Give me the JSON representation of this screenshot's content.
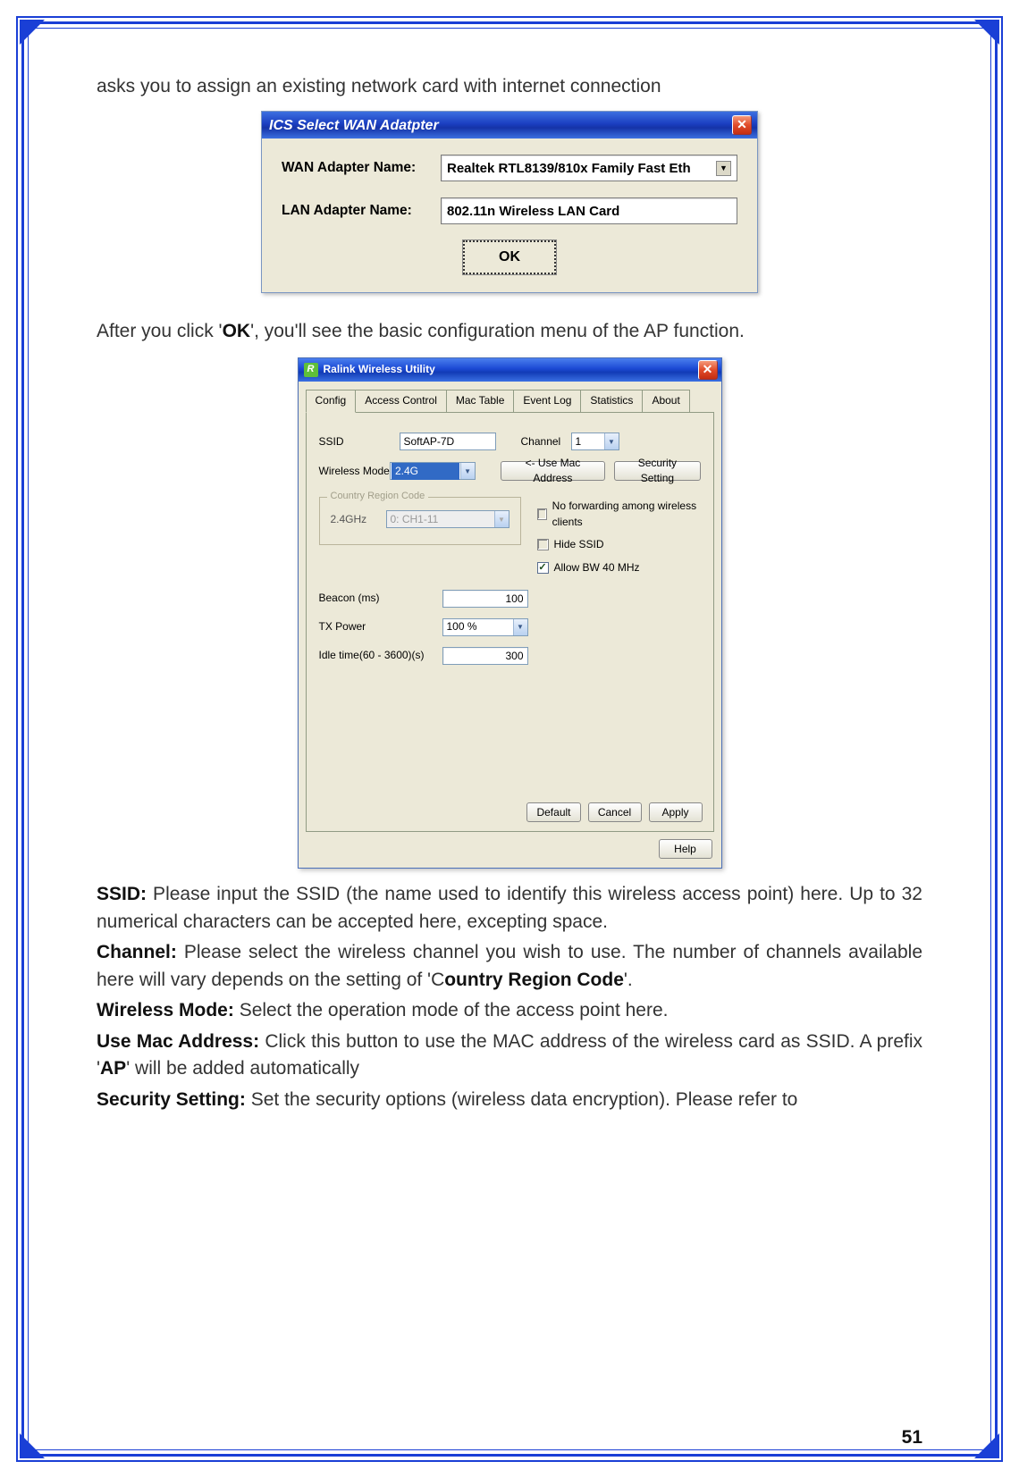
{
  "intro_text": "asks you to assign an existing network card with internet connection",
  "ics_dialog": {
    "title": "ICS Select WAN Adatpter",
    "wan_label": "WAN Adapter Name:",
    "wan_value": "Realtek RTL8139/810x Family Fast Eth",
    "lan_label": "LAN Adapter Name:",
    "lan_value": "802.11n Wireless LAN Card",
    "ok": "OK"
  },
  "after_text_1": "After you click '",
  "after_ok": "OK",
  "after_text_2": "', you'll see the basic configuration menu of the AP function.",
  "ralink": {
    "title": "Ralink Wireless Utility",
    "tabs": [
      "Config",
      "Access Control",
      "Mac Table",
      "Event Log",
      "Statistics",
      "About"
    ],
    "ssid_label": "SSID",
    "ssid_value": "SoftAP-7D",
    "channel_label": "Channel",
    "channel_value": "1",
    "wmode_label": "Wireless Mode",
    "wmode_value": "2.4G",
    "use_mac_btn": "<- Use Mac Address",
    "sec_btn": "Security Setting",
    "crc_legend": "Country Region Code",
    "crc_24_label": "2.4GHz",
    "crc_24_value": "0: CH1-11",
    "chk_nofwd": "No forwarding among wireless clients",
    "chk_hide": "Hide SSID",
    "chk_bw": "Allow BW 40 MHz",
    "beacon_label": "Beacon (ms)",
    "beacon_value": "100",
    "tx_label": "TX Power",
    "tx_value": "100 %",
    "idle_label": "Idle time(60 - 3600)(s)",
    "idle_value": "300",
    "btn_default": "Default",
    "btn_cancel": "Cancel",
    "btn_apply": "Apply",
    "btn_help": "Help"
  },
  "defs": {
    "ssid_h": "SSID:",
    "ssid_t": " Please input the SSID (the name used to identify this wireless access point) here. Up to 32 numerical characters can be accepted here, excepting space.",
    "channel_h": "Channel:",
    "channel_t1": " Please select the wireless channel you wish to use. The number of channels available here will vary depends on the setting of 'C",
    "channel_b": "ountry Region Code",
    "channel_t2": "'.",
    "wmode_h": "Wireless Mode:",
    "wmode_t": " Select the operation mode of the access point here.",
    "mac_h": "Use Mac Address:",
    "mac_t1": " Click this button to use the MAC address of the wireless card as SSID. A prefix '",
    "mac_b": "AP",
    "mac_t2": "' will be added automatically",
    "sec_h": "Security Setting:",
    "sec_t": " Set the security options (wireless data encryption). Please refer to"
  },
  "page_num": "51"
}
